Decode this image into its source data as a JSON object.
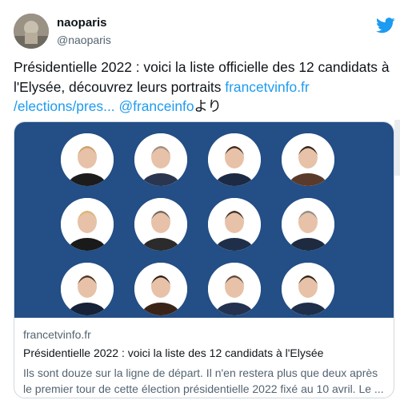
{
  "user": {
    "name": "naoparis",
    "handle": "@naoparis"
  },
  "tweet": {
    "text_main": "Présidentielle 2022 : voici la liste officielle des 12 candidats à l'Elysée, découvrez leurs portraits ",
    "link_1": "francetvinfo.fr",
    "link_2": "/elections/pres...",
    "mention": "@franceinfo",
    "suffix": "より"
  },
  "card": {
    "domain": "francetvinfo.fr",
    "title": "Présidentielle 2022 : voici la liste des 12 candidats à l'Elysée",
    "description": "Ils sont douze sur la ligne de départ. Il n'en restera plus que deux après le premier tour de cette élection présidentielle 2022 fixé au 10 avril. Le ..."
  },
  "colors": {
    "accent": "#1d9bf0",
    "card_background": "#234e86"
  },
  "icons": {
    "logo": "twitter-bird-icon"
  }
}
